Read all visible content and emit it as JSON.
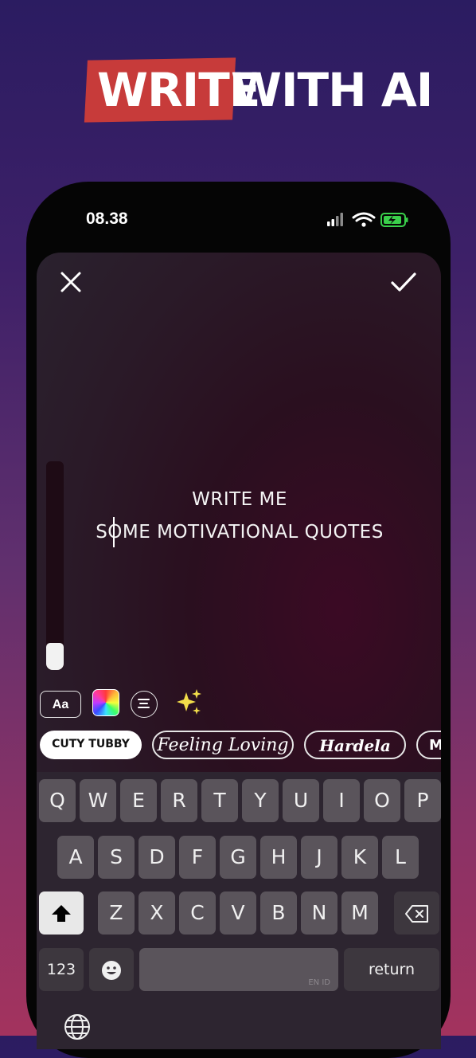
{
  "headline": {
    "highlight": "WRITE",
    "rest": "WITH AI"
  },
  "status": {
    "time": "08.38"
  },
  "editor": {
    "line1": "WRITE ME",
    "line2": "SOME MOTIVATIONAL QUOTES",
    "text_size_level": 0.13
  },
  "toolbar": {
    "font_button": "Aa"
  },
  "fonts": [
    "CUTY TUBBY",
    "Feeling Loving",
    "Hardela",
    "M"
  ],
  "keyboard": {
    "row1": [
      "Q",
      "W",
      "E",
      "R",
      "T",
      "Y",
      "U",
      "I",
      "O",
      "P"
    ],
    "row2": [
      "A",
      "S",
      "D",
      "F",
      "G",
      "H",
      "J",
      "K",
      "L"
    ],
    "row3": [
      "Z",
      "X",
      "C",
      "V",
      "B",
      "N",
      "M"
    ],
    "numbers_key": "123",
    "space_language": "EN ID",
    "return_key": "return"
  },
  "colors": {
    "highlight_red": "#c73b3a",
    "background_top": "#2b1c61",
    "background_bottom": "#a3335e",
    "battery_green": "#3ad04b"
  }
}
